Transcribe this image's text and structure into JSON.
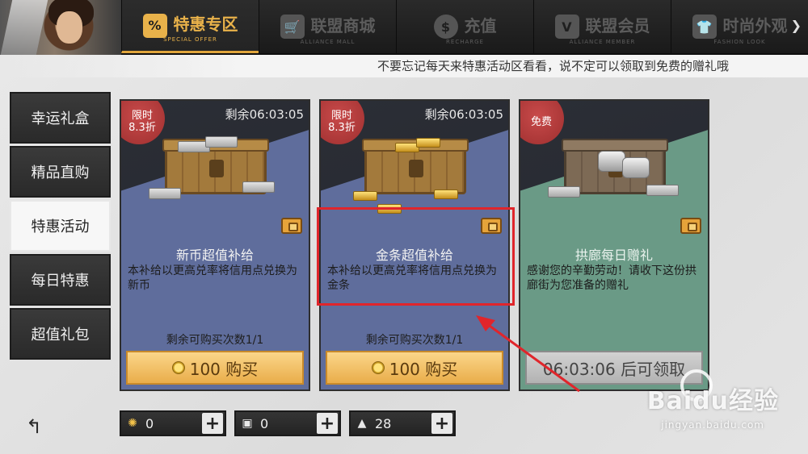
{
  "nav": {
    "tabs": [
      {
        "label": "特惠专区",
        "sub": "SPECIAL OFFER",
        "icon": "%",
        "active": true
      },
      {
        "label": "联盟商城",
        "sub": "ALLIANCE MALL",
        "icon": "🛒",
        "active": false
      },
      {
        "label": "充值",
        "sub": "RECHARGE",
        "icon": "$",
        "active": false
      },
      {
        "label": "联盟会员",
        "sub": "ALLIANCE MEMBER",
        "icon": "V",
        "active": false
      },
      {
        "label": "时尚外观",
        "sub": "FASHION LOOK",
        "icon": "👕",
        "active": false
      }
    ],
    "more_icon": "❯"
  },
  "notice": "不要忘记每天来特惠活动区看看，说不定可以领取到免费的赠礼哦",
  "side_menu": {
    "items": [
      {
        "label": "幸运礼盒",
        "active": false
      },
      {
        "label": "精品直购",
        "active": false
      },
      {
        "label": "特惠活动",
        "active": true
      },
      {
        "label": "每日特惠",
        "active": false
      },
      {
        "label": "超值礼包",
        "active": false
      }
    ]
  },
  "back_icon": "↰",
  "cards": [
    {
      "badge_line1": "限时",
      "badge_line2": "8.3折",
      "timer": "剩余06:03:05",
      "title": "新币超值补给",
      "desc": "本补给以更高兑率将信用点兑换为新币",
      "remain": "剩余可购买次数1/1",
      "button": "100 购买"
    },
    {
      "badge_line1": "限时",
      "badge_line2": "8.3折",
      "timer": "剩余06:03:05",
      "title": "金条超值补给",
      "desc": "本补给以更高兑率将信用点兑换为金条",
      "remain": "剩余可购买次数1/1",
      "button": "100 购买"
    },
    {
      "badge_line1": "免费",
      "badge_line2": "",
      "timer": "",
      "title": "拱廊每日赠礼",
      "desc": "感谢您的辛勤劳动！请收下这份拱廊街为您准备的赠礼",
      "remain": "",
      "button": "06:03:06 后可领取"
    }
  ],
  "currencies": [
    {
      "icon": "coin-icon",
      "value": "0"
    },
    {
      "icon": "banknote-icon",
      "value": "0"
    },
    {
      "icon": "gold-bar-icon",
      "value": "28"
    }
  ],
  "watermark": {
    "text": "Baidu经验",
    "sub": "jingyan.baidu.com"
  },
  "colors": {
    "accent": "#e9b24a",
    "highlight": "#e0252b",
    "badge": "#b33a3a"
  }
}
